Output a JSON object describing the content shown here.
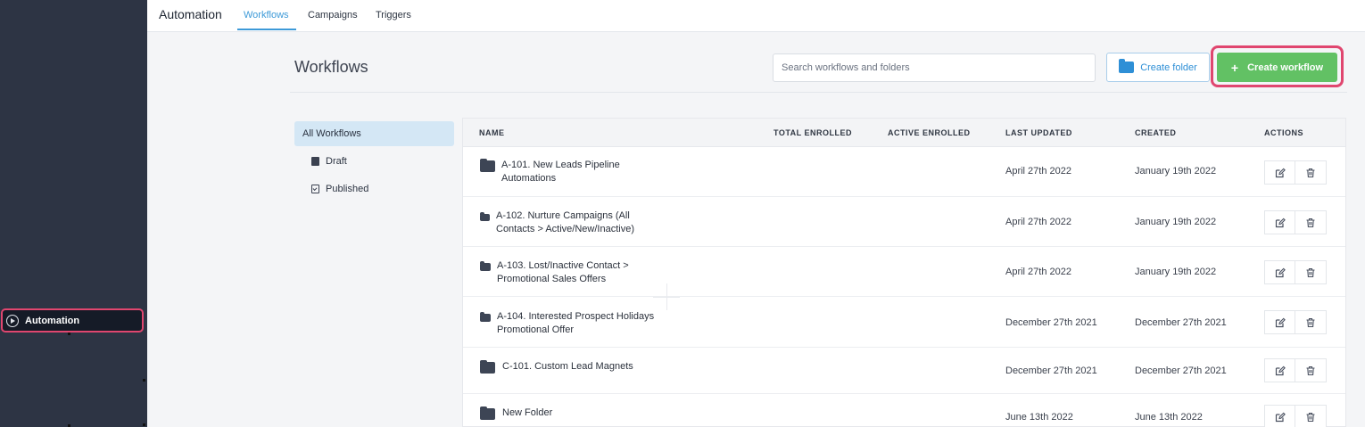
{
  "sidebar": {
    "items": [
      {
        "label": "Automation",
        "icon": "play-circle-icon",
        "highlighted": true
      }
    ]
  },
  "topnav": {
    "app_title": "Automation",
    "tabs": [
      {
        "label": "Workflows",
        "active": true
      },
      {
        "label": "Campaigns",
        "active": false
      },
      {
        "label": "Triggers",
        "active": false
      }
    ]
  },
  "header": {
    "title": "Workflows",
    "search_placeholder": "Search workflows and folders",
    "search_value": "",
    "create_folder_label": "Create folder",
    "create_workflow_label": "Create workflow",
    "create_workflow_icon": "+"
  },
  "filters": {
    "all_label": "All Workflows",
    "items": [
      {
        "label": "Draft",
        "icon": "draft-icon"
      },
      {
        "label": "Published",
        "icon": "calendar-check-icon"
      }
    ]
  },
  "table": {
    "columns": [
      "NAME",
      "TOTAL ENROLLED",
      "ACTIVE ENROLLED",
      "LAST UPDATED",
      "CREATED",
      "ACTIONS"
    ],
    "rows": [
      {
        "name_line1": "A-101. New Leads Pipeline",
        "name_line2": "Automations",
        "total_enrolled": "",
        "active_enrolled": "",
        "last_updated": "April 27th 2022",
        "created": "January 19th 2022"
      },
      {
        "name_line1": "A-102. Nurture Campaigns (All",
        "name_line2": "Contacts > Active/New/Inactive)",
        "total_enrolled": "",
        "active_enrolled": "",
        "last_updated": "April 27th 2022",
        "created": "January 19th 2022"
      },
      {
        "name_line1": "A-103. Lost/Inactive Contact >",
        "name_line2": "Promotional Sales Offers",
        "total_enrolled": "",
        "active_enrolled": "",
        "last_updated": "April 27th 2022",
        "created": "January 19th 2022"
      },
      {
        "name_line1": "A-104. Interested Prospect Holidays",
        "name_line2": "Promotional Offer",
        "total_enrolled": "",
        "active_enrolled": "",
        "last_updated": "December 27th 2021",
        "created": "December 27th 2021"
      },
      {
        "name_line1": "C-101. Custom Lead Magnets",
        "name_line2": "",
        "total_enrolled": "",
        "active_enrolled": "",
        "last_updated": "December 27th 2021",
        "created": "December 27th 2021"
      },
      {
        "name_line1": "New Folder",
        "name_line2": "",
        "total_enrolled": "",
        "active_enrolled": "",
        "last_updated": "June 13th 2022",
        "created": "June 13th 2022"
      }
    ],
    "action_icons": [
      "edit-icon",
      "trash-icon"
    ]
  },
  "colors": {
    "sidebar_bg": "#2d3444",
    "accent_blue": "#3d9ad8",
    "create_green": "#62c164",
    "highlight_pink": "#e0466f"
  }
}
